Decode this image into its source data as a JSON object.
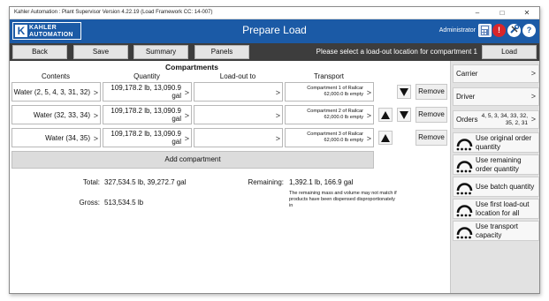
{
  "window": {
    "title": "Kahler Automation : Plant Supervisor Version 4.22.19 (Load Framework CC: 14-007)",
    "min": "–",
    "max": "□",
    "close": "✕"
  },
  "header": {
    "logo_k": "K",
    "logo_line1": "KAHLER",
    "logo_line2": "AUTOMATION",
    "title": "Prepare Load",
    "user": "Administrator",
    "icons": [
      "calculator-icon",
      "alert-icon",
      "tools-icon",
      "help-icon"
    ],
    "alert_glyph": "!",
    "help_glyph": "?"
  },
  "toolbar": {
    "back": "Back",
    "save": "Save",
    "summary": "Summary",
    "panels": "Panels",
    "message": "Please select a load-out location for compartment 1",
    "load": "Load"
  },
  "compartments": {
    "title": "Compartments",
    "headers": {
      "contents": "Contents",
      "quantity": "Quantity",
      "loadout": "Load-out to",
      "transport": "Transport"
    },
    "chevron": ">",
    "remove_label": "Remove",
    "rows": [
      {
        "contents": "Water (2, 5, 4, 3, 31, 32)",
        "quantity": "109,178.2 lb, 13,090.9 gal",
        "loadout": "",
        "transport_line1": "Compartment 1 of Railcar",
        "transport_line2": "62,000.0 lb empty",
        "up": false,
        "down": true
      },
      {
        "contents": "Water (32, 33, 34)",
        "quantity": "109,178.2 lb, 13,090.9 gal",
        "loadout": "",
        "transport_line1": "Compartment 2 of Railcar",
        "transport_line2": "62,000.0 lb empty",
        "up": true,
        "down": true
      },
      {
        "contents": "Water (34, 35)",
        "quantity": "109,178.2 lb, 13,090.9 gal",
        "loadout": "",
        "transport_line1": "Compartment 3 of Railcar",
        "transport_line2": "62,000.0 lb empty",
        "up": true,
        "down": false
      }
    ],
    "add_label": "Add compartment"
  },
  "totals": {
    "total_label": "Total:",
    "total_value": "327,534.5 lb, 39,272.7 gal",
    "gross_label": "Gross:",
    "gross_value": "513,534.5 lb",
    "remaining_label": "Remaining:",
    "remaining_value": "1,392.1 lb, 166.9 gal",
    "note": "The remaining mass and volume may not match if products have been dispensed disproportionately in"
  },
  "sidebar": {
    "carrier": "Carrier",
    "driver": "Driver",
    "orders_label": "Orders",
    "orders_value": "4, 5, 3, 34, 33, 32, 35, 2, 31",
    "chevron": ">",
    "toggles": [
      {
        "label": "Use original order quantity"
      },
      {
        "label": "Use remaining order quantity"
      },
      {
        "label": "Use batch quantity"
      },
      {
        "label": "Use first load-out location for all"
      },
      {
        "label": "Use transport capacity"
      }
    ]
  },
  "colors": {
    "header_blue": "#1b5aa6",
    "toolbar_dark": "#3d3d3d",
    "alert_red": "#d8262a",
    "sidebar_gray": "#e2e2e2"
  }
}
